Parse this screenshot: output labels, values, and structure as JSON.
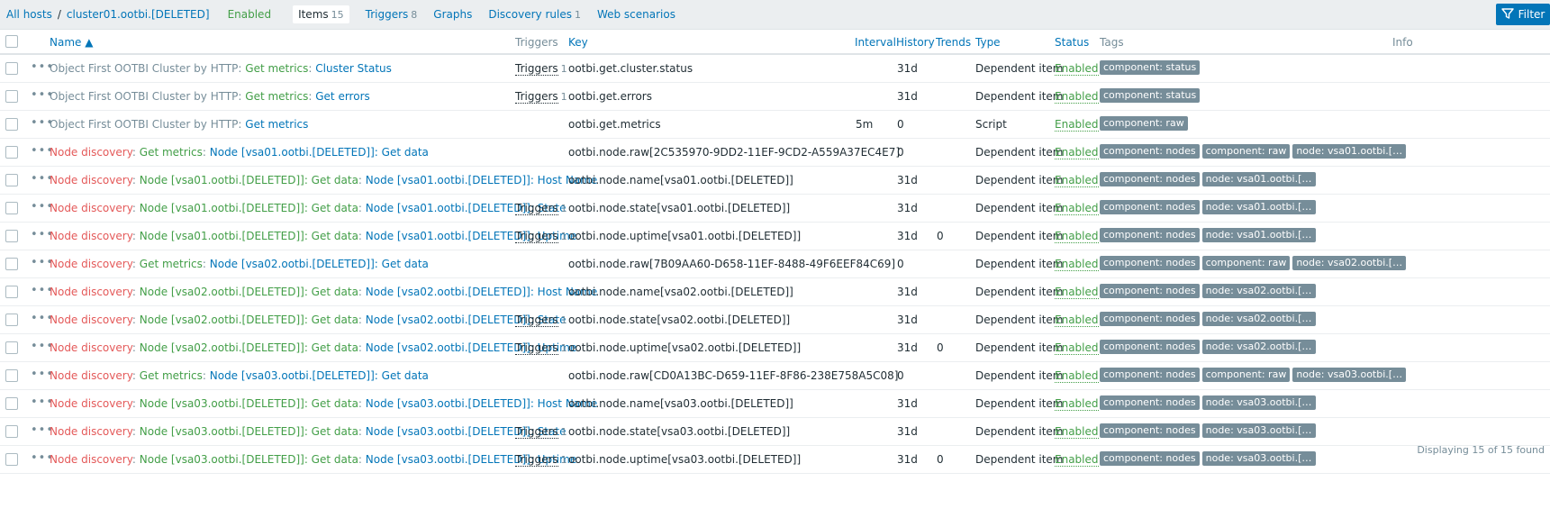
{
  "breadcrumb": {
    "all_hosts": "All hosts",
    "separator": "/",
    "host": "cluster01.ootbi.[DELETED]",
    "status": "Enabled"
  },
  "tabs": [
    {
      "label": "Items",
      "count": "15",
      "active": true
    },
    {
      "label": "Triggers",
      "count": "8"
    },
    {
      "label": "Graphs",
      "count": ""
    },
    {
      "label": "Discovery rules",
      "count": "1"
    },
    {
      "label": "Web scenarios",
      "count": ""
    }
  ],
  "filter_label": "Filter",
  "columns": {
    "name": "Name ▲",
    "triggers": "Triggers",
    "key": "Key",
    "interval": "Interval",
    "history": "History",
    "trends": "Trends",
    "type": "Type",
    "status": "Status",
    "tags": "Tags",
    "info": "Info"
  },
  "rows": [
    {
      "name": [
        [
          "Object First OOTBI Cluster by HTTP",
          "g"
        ],
        [
          ": ",
          "g"
        ],
        [
          "Get metrics",
          "gr"
        ],
        [
          ": ",
          "g"
        ],
        [
          "Cluster Status",
          "b"
        ]
      ],
      "triggers": "Triggers",
      "triggers_count": "1",
      "key": "ootbi.get.cluster.status",
      "interval": "",
      "history": "31d",
      "trends": "",
      "type": "Dependent item",
      "status": "Enabled",
      "tags": [
        "component: status"
      ]
    },
    {
      "name": [
        [
          "Object First OOTBI Cluster by HTTP",
          "g"
        ],
        [
          ": ",
          "g"
        ],
        [
          "Get metrics",
          "gr"
        ],
        [
          ": ",
          "g"
        ],
        [
          "Get errors",
          "b"
        ]
      ],
      "triggers": "Triggers",
      "triggers_count": "1",
      "key": "ootbi.get.errors",
      "interval": "",
      "history": "31d",
      "trends": "",
      "type": "Dependent item",
      "status": "Enabled",
      "tags": [
        "component: status"
      ]
    },
    {
      "name": [
        [
          "Object First OOTBI Cluster by HTTP",
          "g"
        ],
        [
          ": ",
          "g"
        ],
        [
          "Get metrics",
          "b"
        ]
      ],
      "triggers": "",
      "triggers_count": "",
      "key": "ootbi.get.metrics",
      "interval": "5m",
      "history": "0",
      "trends": "",
      "type": "Script",
      "status": "Enabled",
      "tags": [
        "component: raw"
      ]
    },
    {
      "name": [
        [
          "Node discovery",
          "r"
        ],
        [
          ": ",
          "g"
        ],
        [
          "Get metrics",
          "gr"
        ],
        [
          ": ",
          "g"
        ],
        [
          "Node [vsa01.ootbi.[DELETED]]: Get data",
          "b"
        ]
      ],
      "triggers": "",
      "triggers_count": "",
      "key": "ootbi.node.raw[2C535970-9DD2-11EF-9CD2-A559A37EC4E7]",
      "interval": "",
      "history": "0",
      "trends": "",
      "type": "Dependent item",
      "status": "Enabled",
      "tags": [
        "component: nodes",
        "component: raw",
        "node: vsa01.ootbi.[DE..."
      ]
    },
    {
      "name": [
        [
          "Node discovery",
          "r"
        ],
        [
          ": ",
          "g"
        ],
        [
          "Node [vsa01.ootbi.[DELETED]]: Get data",
          "gr"
        ],
        [
          ": ",
          "g"
        ],
        [
          "Node [vsa01.ootbi.[DELETED]]: Host Name",
          "b"
        ]
      ],
      "triggers": "",
      "triggers_count": "",
      "key": "ootbi.node.name[vsa01.ootbi.[DELETED]]",
      "interval": "",
      "history": "31d",
      "trends": "",
      "type": "Dependent item",
      "status": "Enabled",
      "tags": [
        "component: nodes",
        "node: vsa01.ootbi.[DE..."
      ]
    },
    {
      "name": [
        [
          "Node discovery",
          "r"
        ],
        [
          ": ",
          "g"
        ],
        [
          "Node [vsa01.ootbi.[DELETED]]: Get data",
          "gr"
        ],
        [
          ": ",
          "g"
        ],
        [
          "Node [vsa01.ootbi.[DELETED]]: State",
          "b"
        ]
      ],
      "triggers": "Triggers",
      "triggers_count": "1",
      "key": "ootbi.node.state[vsa01.ootbi.[DELETED]]",
      "interval": "",
      "history": "31d",
      "trends": "",
      "type": "Dependent item",
      "status": "Enabled",
      "tags": [
        "component: nodes",
        "node: vsa01.ootbi.[DE..."
      ]
    },
    {
      "name": [
        [
          "Node discovery",
          "r"
        ],
        [
          ": ",
          "g"
        ],
        [
          "Node [vsa01.ootbi.[DELETED]]: Get data",
          "gr"
        ],
        [
          ": ",
          "g"
        ],
        [
          "Node [vsa01.ootbi.[DELETED]]: Uptime",
          "b"
        ]
      ],
      "triggers": "Triggers",
      "triggers_count": "1",
      "key": "ootbi.node.uptime[vsa01.ootbi.[DELETED]]",
      "interval": "",
      "history": "31d",
      "trends": "0",
      "type": "Dependent item",
      "status": "Enabled",
      "tags": [
        "component: nodes",
        "node: vsa01.ootbi.[DE..."
      ]
    },
    {
      "name": [
        [
          "Node discovery",
          "r"
        ],
        [
          ": ",
          "g"
        ],
        [
          "Get metrics",
          "gr"
        ],
        [
          ": ",
          "g"
        ],
        [
          "Node [vsa02.ootbi.[DELETED]]: Get data",
          "b"
        ]
      ],
      "triggers": "",
      "triggers_count": "",
      "key": "ootbi.node.raw[7B09AA60-D658-11EF-8488-49F6EEF84C69]",
      "interval": "",
      "history": "0",
      "trends": "",
      "type": "Dependent item",
      "status": "Enabled",
      "tags": [
        "component: nodes",
        "component: raw",
        "node: vsa02.ootbi.[DE..."
      ]
    },
    {
      "name": [
        [
          "Node discovery",
          "r"
        ],
        [
          ": ",
          "g"
        ],
        [
          "Node [vsa02.ootbi.[DELETED]]: Get data",
          "gr"
        ],
        [
          ": ",
          "g"
        ],
        [
          "Node [vsa02.ootbi.[DELETED]]: Host Name",
          "b"
        ]
      ],
      "triggers": "",
      "triggers_count": "",
      "key": "ootbi.node.name[vsa02.ootbi.[DELETED]]",
      "interval": "",
      "history": "31d",
      "trends": "",
      "type": "Dependent item",
      "status": "Enabled",
      "tags": [
        "component: nodes",
        "node: vsa02.ootbi.[DE..."
      ]
    },
    {
      "name": [
        [
          "Node discovery",
          "r"
        ],
        [
          ": ",
          "g"
        ],
        [
          "Node [vsa02.ootbi.[DELETED]]: Get data",
          "gr"
        ],
        [
          ": ",
          "g"
        ],
        [
          "Node [vsa02.ootbi.[DELETED]]: State",
          "b"
        ]
      ],
      "triggers": "Triggers",
      "triggers_count": "1",
      "key": "ootbi.node.state[vsa02.ootbi.[DELETED]]",
      "interval": "",
      "history": "31d",
      "trends": "",
      "type": "Dependent item",
      "status": "Enabled",
      "tags": [
        "component: nodes",
        "node: vsa02.ootbi.[DE..."
      ]
    },
    {
      "name": [
        [
          "Node discovery",
          "r"
        ],
        [
          ": ",
          "g"
        ],
        [
          "Node [vsa02.ootbi.[DELETED]]: Get data",
          "gr"
        ],
        [
          ": ",
          "g"
        ],
        [
          "Node [vsa02.ootbi.[DELETED]]: Uptime",
          "b"
        ]
      ],
      "triggers": "Triggers",
      "triggers_count": "1",
      "key": "ootbi.node.uptime[vsa02.ootbi.[DELETED]]",
      "interval": "",
      "history": "31d",
      "trends": "0",
      "type": "Dependent item",
      "status": "Enabled",
      "tags": [
        "component: nodes",
        "node: vsa02.ootbi.[DE..."
      ]
    },
    {
      "name": [
        [
          "Node discovery",
          "r"
        ],
        [
          ": ",
          "g"
        ],
        [
          "Get metrics",
          "gr"
        ],
        [
          ": ",
          "g"
        ],
        [
          "Node [vsa03.ootbi.[DELETED]]: Get data",
          "b"
        ]
      ],
      "triggers": "",
      "triggers_count": "",
      "key": "ootbi.node.raw[CD0A13BC-D659-11EF-8F86-238E758A5C08]",
      "interval": "",
      "history": "0",
      "trends": "",
      "type": "Dependent item",
      "status": "Enabled",
      "tags": [
        "component: nodes",
        "component: raw",
        "node: vsa03.ootbi.[DE..."
      ]
    },
    {
      "name": [
        [
          "Node discovery",
          "r"
        ],
        [
          ": ",
          "g"
        ],
        [
          "Node [vsa03.ootbi.[DELETED]]: Get data",
          "gr"
        ],
        [
          ": ",
          "g"
        ],
        [
          "Node [vsa03.ootbi.[DELETED]]: Host Name",
          "b"
        ]
      ],
      "triggers": "",
      "triggers_count": "",
      "key": "ootbi.node.name[vsa03.ootbi.[DELETED]]",
      "interval": "",
      "history": "31d",
      "trends": "",
      "type": "Dependent item",
      "status": "Enabled",
      "tags": [
        "component: nodes",
        "node: vsa03.ootbi.[DE..."
      ]
    },
    {
      "name": [
        [
          "Node discovery",
          "r"
        ],
        [
          ": ",
          "g"
        ],
        [
          "Node [vsa03.ootbi.[DELETED]]: Get data",
          "gr"
        ],
        [
          ": ",
          "g"
        ],
        [
          "Node [vsa03.ootbi.[DELETED]]: State",
          "b"
        ]
      ],
      "triggers": "Triggers",
      "triggers_count": "1",
      "key": "ootbi.node.state[vsa03.ootbi.[DELETED]]",
      "interval": "",
      "history": "31d",
      "trends": "",
      "type": "Dependent item",
      "status": "Enabled",
      "tags": [
        "component: nodes",
        "node: vsa03.ootbi.[DE..."
      ]
    },
    {
      "name": [
        [
          "Node discovery",
          "r"
        ],
        [
          ": ",
          "g"
        ],
        [
          "Node [vsa03.ootbi.[DELETED]]: Get data",
          "gr"
        ],
        [
          ": ",
          "g"
        ],
        [
          "Node [vsa03.ootbi.[DELETED]]: Uptime",
          "b"
        ]
      ],
      "triggers": "Triggers",
      "triggers_count": "1",
      "key": "ootbi.node.uptime[vsa03.ootbi.[DELETED]]",
      "interval": "",
      "history": "31d",
      "trends": "0",
      "type": "Dependent item",
      "status": "Enabled",
      "tags": [
        "component: nodes",
        "node: vsa03.ootbi.[DE..."
      ]
    }
  ],
  "footer": "Displaying 15 of 15 found",
  "icons": {
    "filter": "filter-icon",
    "row_menu": "ellipsis-icon"
  },
  "colors": {
    "accent": "#0275b8",
    "enabled": "#429e47",
    "discovery": "#e45959",
    "muted": "#768d99",
    "tag_bg": "#768d99"
  }
}
